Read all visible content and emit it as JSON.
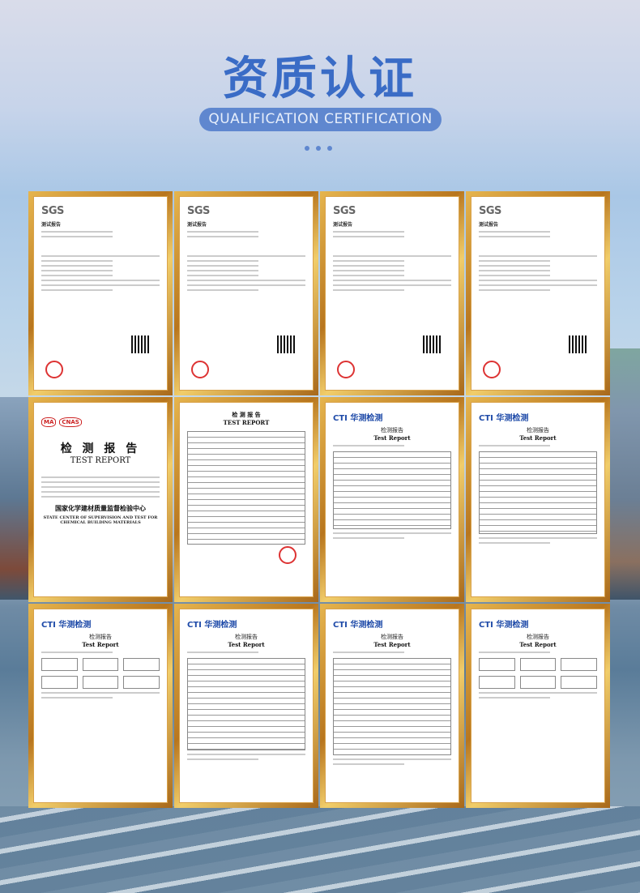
{
  "header": {
    "title": "资质认证",
    "subtitle": "QUALIFICATION CERTIFICATION"
  },
  "certificates": [
    {
      "type": "sgs",
      "brand": "SGS",
      "heading": "测试报告"
    },
    {
      "type": "sgs",
      "brand": "SGS",
      "heading": "测试报告"
    },
    {
      "type": "sgs",
      "brand": "SGS",
      "heading": "测试报告"
    },
    {
      "type": "sgs",
      "brand": "SGS",
      "heading": "测试报告"
    },
    {
      "type": "state",
      "logos": [
        "MA",
        "CNAS"
      ],
      "title_cn": "检 测 报 告",
      "title_en": "TEST REPORT",
      "issuer_cn": "国家化学建材质量监督检验中心",
      "issuer_en": "STATE CENTER OF SUPERVISION AND TEST FOR CHEMICAL BUILDING MATERIALS"
    },
    {
      "type": "table",
      "title_cn": "检 测 报 告",
      "title_en": "TEST REPORT"
    },
    {
      "type": "cti",
      "brand": "CTI 华测检测",
      "title_cn": "检测报告",
      "title_en": "Test Report"
    },
    {
      "type": "cti",
      "brand": "CTI 华测检测",
      "title_cn": "检测报告",
      "title_en": "Test Report"
    },
    {
      "type": "cti",
      "brand": "CTI 华测检测",
      "title_cn": "检测报告",
      "title_en": "Test Report"
    },
    {
      "type": "cti",
      "brand": "CTI 华测检测",
      "title_cn": "检测报告",
      "title_en": "Test Report"
    },
    {
      "type": "cti",
      "brand": "CTI 华测检测",
      "title_cn": "检测报告",
      "title_en": "Test Report"
    },
    {
      "type": "cti",
      "brand": "CTI 华测检测",
      "title_cn": "检测报告",
      "title_en": "Test Report"
    }
  ],
  "colors": {
    "title": "#3a6cc6",
    "pill": "#5f87cf",
    "frame": "#d9a24a"
  }
}
